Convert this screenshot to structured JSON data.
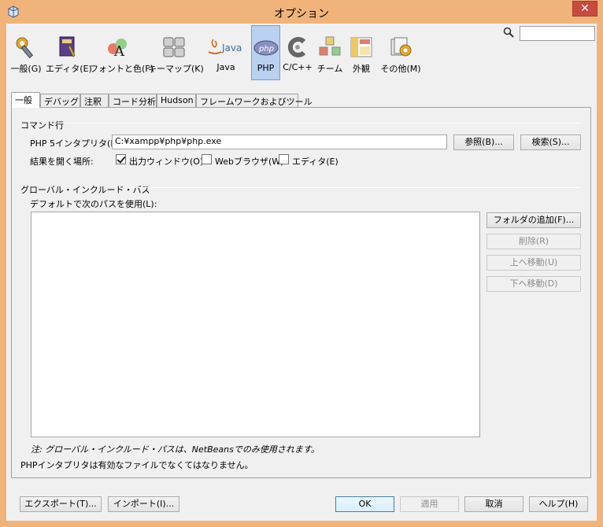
{
  "window": {
    "title": "オプション",
    "close_glyph": "✕"
  },
  "toolbar": {
    "categories": [
      {
        "label": "一般(G)",
        "icon": "gear-wrench-icon"
      },
      {
        "label": "エディタ(E)",
        "icon": "editor-book-icon"
      },
      {
        "label": "フォントと色(F)",
        "icon": "font-color-icon"
      },
      {
        "label": "キーマップ(K)",
        "icon": "keyboard-icon"
      },
      {
        "label": "Java",
        "icon": "java-icon"
      },
      {
        "label": "PHP",
        "icon": "php-icon"
      },
      {
        "label": "C/C++",
        "icon": "cpp-icon"
      },
      {
        "label": "チーム",
        "icon": "team-cubes-icon"
      },
      {
        "label": "外観",
        "icon": "appearance-icon"
      },
      {
        "label": "その他(M)",
        "icon": "misc-icon"
      }
    ],
    "java_logo_text": "Java",
    "php_logo_text": "php",
    "search_value": ""
  },
  "tabs": [
    "一般",
    "デバッグ",
    "注釈",
    "コード分析",
    "Hudson",
    "フレームワークおよびツール"
  ],
  "command_line": {
    "section": "コマンド行",
    "interpreter_label": "PHP 5インタプリタ(P):",
    "interpreter_value": "C:¥xampp¥php¥php.exe",
    "browse": "参照(B)...",
    "search": "検索(S)...",
    "open_results_label": "結果を開く場所:",
    "output_window": "出力ウィンドウ(O)",
    "web_browser": "Webブラウザ(W)",
    "editor": "エディタ(E)"
  },
  "include_path": {
    "section": "グローバル・インクルード・パス",
    "default_label": "デフォルトで次のパスを使用(L):",
    "add_folder": "フォルダの追加(F)...",
    "remove": "削除(R)",
    "move_up": "上へ移動(U)",
    "move_down": "下へ移動(D)",
    "note": "注: グローバル・インクルード・パスは、NetBeansでのみ使用されます。"
  },
  "status_message": "PHPインタプリタは有効なファイルでなくてはなりません。",
  "footer": {
    "export": "エクスポート(T)...",
    "import": "インポート(I)...",
    "ok": "OK",
    "apply": "適用",
    "cancel": "取消",
    "help": "ヘルプ(H)"
  },
  "colors": {
    "frame": "#f0b47a",
    "close": "#c74a3f",
    "selected_category": "#b9d0f1"
  }
}
